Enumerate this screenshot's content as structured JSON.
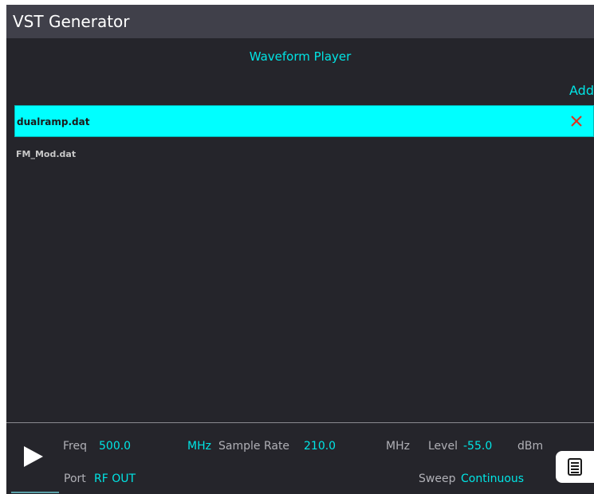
{
  "app": {
    "title": "VST Generator"
  },
  "player": {
    "heading": "Waveform Player",
    "add_label": "Add",
    "files": [
      {
        "name": "dualramp.dat",
        "selected": true
      },
      {
        "name": "FM_Mod.dat",
        "selected": false
      }
    ]
  },
  "status": {
    "freq_label": "Freq",
    "freq_value": "500.0",
    "freq_unit": "MHz",
    "sample_rate_label": "Sample Rate",
    "sample_rate_value": "210.0",
    "sample_rate_unit": "MHz",
    "level_label": "Level",
    "level_value": "-55.0",
    "level_unit": "dBm",
    "port_label": "Port",
    "port_value": "RF OUT",
    "sweep_label": "Sweep",
    "sweep_value": "Continuous"
  },
  "icons": {
    "play": "play-icon",
    "delete": "close-icon",
    "menu": "menu-icon"
  },
  "colors": {
    "accent": "#00e5e5",
    "selected_row": "#00ffff",
    "delete": "#e0301e",
    "background": "#25252b",
    "titlebar": "#40404a"
  }
}
